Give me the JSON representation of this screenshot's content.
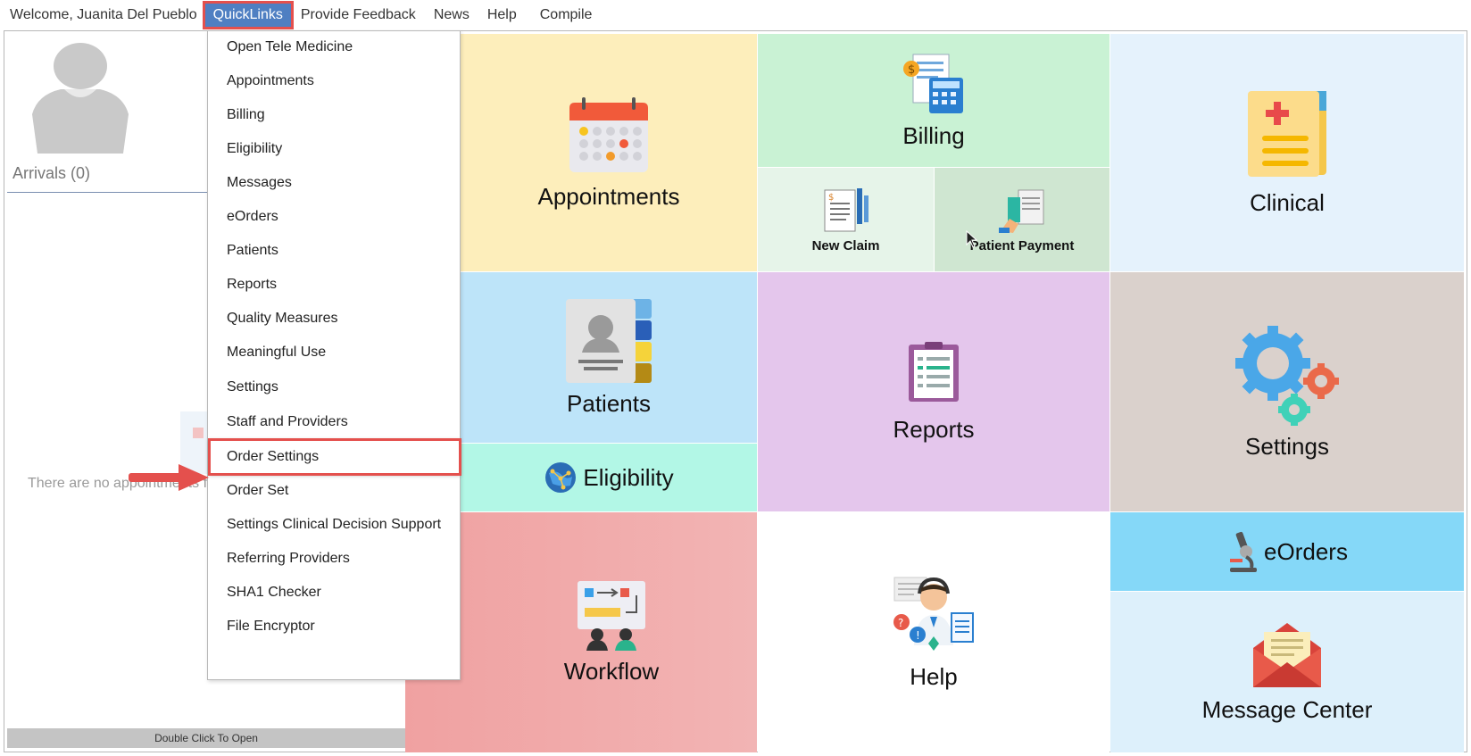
{
  "menubar": {
    "welcome": "Welcome, Juanita Del Pueblo",
    "items": [
      {
        "label": "QuickLinks",
        "active": true
      },
      {
        "label": "Provide Feedback"
      },
      {
        "label": "News"
      },
      {
        "label": "Help"
      },
      {
        "label": "Compile"
      }
    ]
  },
  "left_panel": {
    "arrivals": "Arrivals (0)",
    "empty_message": "There are no appointments f",
    "footer": "Double Click To Open"
  },
  "quicklinks": {
    "items": [
      "Open Tele Medicine",
      "Appointments",
      "Billing",
      "Eligibility",
      "Messages",
      "eOrders",
      "Patients",
      "Reports",
      "Quality Measures",
      "Meaningful Use",
      "Settings",
      "Staff and Providers",
      "Order Settings",
      "Order Set",
      "Settings Clinical Decision Support",
      "Referring Providers",
      "SHA1 Checker",
      "File Encryptor"
    ],
    "highlighted": "Order Settings"
  },
  "tiles": {
    "appointments": "Appointments",
    "billing": "Billing",
    "new_claim": "New Claim",
    "patient_payment": "Patient Payment",
    "clinical": "Clinical",
    "patients": "Patients",
    "eligibility": "Eligibility",
    "reports": "Reports",
    "settings": "Settings",
    "workflow": "Workflow",
    "help": "Help",
    "eorders": "eOrders",
    "message_center": "Message Center"
  },
  "icons": {
    "appointments": "calendar-icon",
    "billing": "billing-calculator-icon",
    "clinical": "medical-folder-icon",
    "patients": "contact-book-icon",
    "eligibility": "globe-network-icon",
    "reports": "clipboard-icon",
    "settings": "gears-icon",
    "workflow": "workflow-board-icon",
    "help": "support-agent-icon",
    "eorders": "microscope-icon",
    "message_center": "envelope-icon"
  },
  "colors": {
    "accent_menu": "#4f7fc2",
    "highlight_red": "#e4504d"
  }
}
